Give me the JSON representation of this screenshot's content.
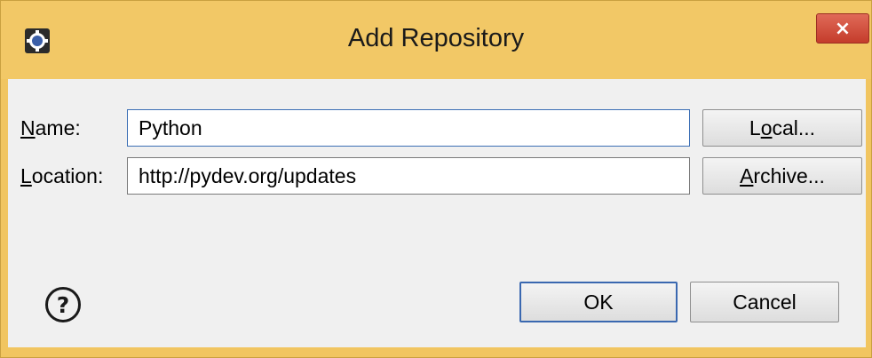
{
  "window": {
    "title": "Add Repository",
    "close_glyph": "×",
    "app_icon": "eclipse-gear-icon"
  },
  "form": {
    "name_label_accel": "N",
    "name_label_rest": "ame:",
    "name_value": "Python",
    "location_label_accel": "L",
    "location_label_rest": "ocation:",
    "location_value": "http://pydev.org/updates"
  },
  "buttons": {
    "local_pre": "L",
    "local_accel": "o",
    "local_post": "cal...",
    "archive_accel": "A",
    "archive_post": "rchive...",
    "ok": "OK",
    "cancel": "Cancel"
  },
  "help": {
    "glyph": "?"
  },
  "colors": {
    "frame": "#f1c560",
    "client": "#f0f0f0",
    "close": "#c43c2b",
    "default_border": "#3a68b0"
  }
}
